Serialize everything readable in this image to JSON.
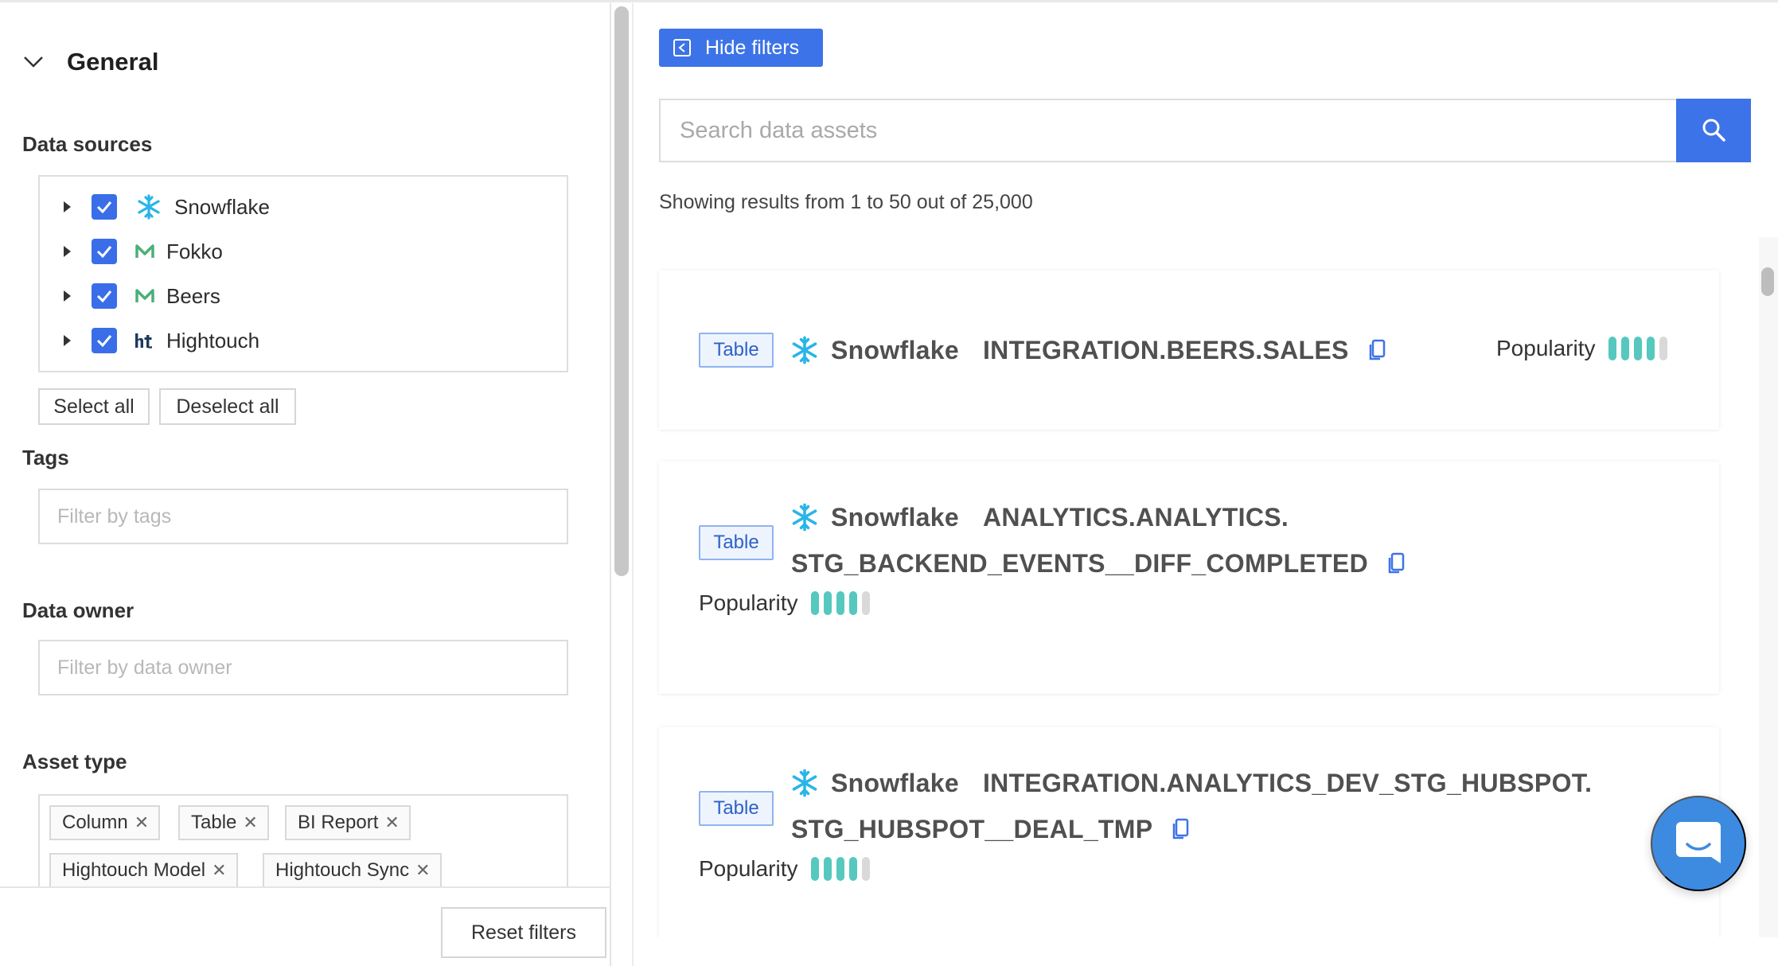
{
  "filters": {
    "general_title": "General",
    "data_sources_label": "Data sources",
    "data_sources": [
      {
        "label": "Snowflake",
        "checked": true,
        "icon": "snowflake-icon"
      },
      {
        "label": "Fokko",
        "checked": true,
        "icon": "m-logo-icon"
      },
      {
        "label": "Beers",
        "checked": true,
        "icon": "m-logo-icon"
      },
      {
        "label": "Hightouch",
        "checked": true,
        "icon": "hightouch-icon"
      }
    ],
    "select_all": "Select all",
    "deselect_all": "Deselect all",
    "tags_label": "Tags",
    "tags_placeholder": "Filter by tags",
    "owner_label": "Data owner",
    "owner_placeholder": "Filter by data owner",
    "asset_type_label": "Asset type",
    "asset_types": [
      "Column",
      "Table",
      "BI Report",
      "Hightouch Model",
      "Hightouch Sync"
    ],
    "reset": "Reset filters"
  },
  "toolbar": {
    "hide_filters": "Hide filters"
  },
  "search": {
    "placeholder": "Search data assets"
  },
  "results": {
    "summary": "Showing results from 1 to 50 out of 25,000",
    "popularity_label": "Popularity",
    "items": [
      {
        "type": "Table",
        "source": "Snowflake",
        "path_line1": "INTEGRATION.BEERS.SALES",
        "path_line2": "",
        "popularity": 4,
        "popularity_max": 5
      },
      {
        "type": "Table",
        "source": "Snowflake",
        "path_line1": "ANALYTICS.ANALYTICS.",
        "path_line2": "STG_BACKEND_EVENTS__DIFF_COMPLETED",
        "popularity": 4,
        "popularity_max": 5
      },
      {
        "type": "Table",
        "source": "Snowflake",
        "path_line1": "INTEGRATION.ANALYTICS_DEV_STG_HUBSPOT.",
        "path_line2": "STG_HUBSPOT__DEAL_TMP",
        "popularity": 4,
        "popularity_max": 5
      }
    ]
  },
  "colors": {
    "accent": "#3d73e8",
    "popularity_on": "#56c8be",
    "popularity_off": "#d9d9d9",
    "snowflake": "#29b5e8",
    "m_logo": "#4caf78"
  }
}
